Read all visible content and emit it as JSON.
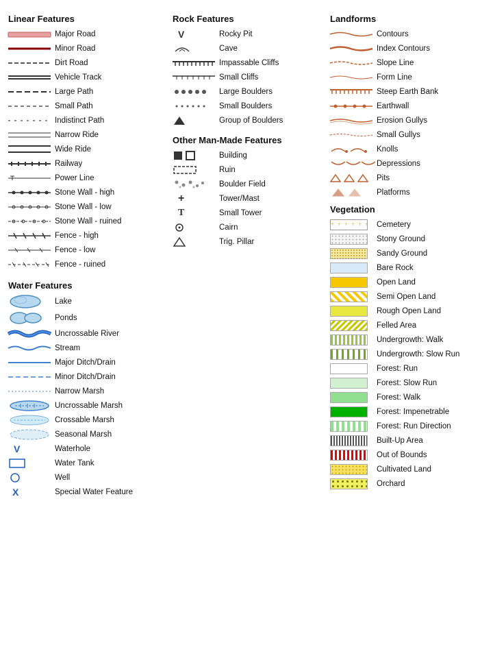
{
  "sections": {
    "linear": {
      "title": "Linear Features",
      "items": [
        {
          "label": "Major Road"
        },
        {
          "label": "Minor Road"
        },
        {
          "label": "Dirt Road"
        },
        {
          "label": "Vehicle Track"
        },
        {
          "label": "Large Path"
        },
        {
          "label": "Small Path"
        },
        {
          "label": "Indistinct Path"
        },
        {
          "label": "Narrow Ride"
        },
        {
          "label": "Wide Ride"
        },
        {
          "label": "Railway"
        },
        {
          "label": "Power Line"
        },
        {
          "label": "Stone Wall - high"
        },
        {
          "label": "Stone Wall - low"
        },
        {
          "label": "Stone Wall - ruined"
        },
        {
          "label": "Fence - high"
        },
        {
          "label": "Fence - low"
        },
        {
          "label": "Fence - ruined"
        }
      ]
    },
    "water": {
      "title": "Water Features",
      "items": [
        {
          "label": "Lake"
        },
        {
          "label": "Ponds"
        },
        {
          "label": "Uncrossable River"
        },
        {
          "label": "Stream"
        },
        {
          "label": "Major Ditch/Drain"
        },
        {
          "label": "Minor Ditch/Drain"
        },
        {
          "label": "Narrow Marsh"
        },
        {
          "label": "Uncrossable Marsh"
        },
        {
          "label": "Crossable Marsh"
        },
        {
          "label": "Seasonal Marsh"
        },
        {
          "label": "Waterhole"
        },
        {
          "label": "Water Tank"
        },
        {
          "label": "Well"
        },
        {
          "label": "Special Water Feature"
        }
      ]
    },
    "rock": {
      "title": "Rock Features",
      "items": [
        {
          "label": "Rocky Pit",
          "symbol": "V"
        },
        {
          "label": "Cave",
          "symbol": "⌒"
        },
        {
          "label": "Impassable Cliffs"
        },
        {
          "label": "Small Cliffs"
        },
        {
          "label": "Large Boulders"
        },
        {
          "label": "Small Boulders"
        },
        {
          "label": "Group of Boulders",
          "symbol": "▲"
        }
      ]
    },
    "manmade": {
      "title": "Other Man-Made Features",
      "items": [
        {
          "label": "Building"
        },
        {
          "label": "Ruin"
        },
        {
          "label": "Boulder Field"
        },
        {
          "label": "Tower/Mast",
          "symbol": "+"
        },
        {
          "label": "Small Tower",
          "symbol": "T"
        },
        {
          "label": "Cairn",
          "symbol": "⊙"
        },
        {
          "label": "Trig. Pillar",
          "symbol": "△"
        }
      ]
    },
    "landforms": {
      "title": "Landforms",
      "items": [
        {
          "label": "Contours"
        },
        {
          "label": "Index Contours"
        },
        {
          "label": "Slope Line"
        },
        {
          "label": "Form Line"
        },
        {
          "label": "Steep Earth Bank"
        },
        {
          "label": "Earthwall"
        },
        {
          "label": "Erosion Gullys"
        },
        {
          "label": "Small Gullys"
        },
        {
          "label": "Knolls"
        },
        {
          "label": "Depressions"
        },
        {
          "label": "Pits"
        },
        {
          "label": "Platforms"
        }
      ]
    },
    "vegetation": {
      "title": "Vegetation",
      "items": [
        {
          "label": "Cemetery",
          "swatch": "cemetery"
        },
        {
          "label": "Stony Ground",
          "swatch": "stony"
        },
        {
          "label": "Sandy Ground",
          "swatch": "sandy"
        },
        {
          "label": "Bare Rock",
          "swatch": "bare-rock"
        },
        {
          "label": "Open Land",
          "swatch": "open-land"
        },
        {
          "label": "Semi Open Land",
          "swatch": "semi-open"
        },
        {
          "label": "Rough Open Land",
          "swatch": "rough-open"
        },
        {
          "label": "Felled Area",
          "swatch": "felled"
        },
        {
          "label": "Undergrowth: Walk",
          "swatch": "under-walk"
        },
        {
          "label": "Undergrowth: Slow Run",
          "swatch": "under-slow"
        },
        {
          "label": "Forest: Run",
          "swatch": "forest-run"
        },
        {
          "label": "Forest: Slow Run",
          "swatch": "forest-slow"
        },
        {
          "label": "Forest: Walk",
          "swatch": "forest-walk"
        },
        {
          "label": "Forest: Impenetrable",
          "swatch": "forest-imp"
        },
        {
          "label": "Forest: Run Direction",
          "swatch": "forest-dir"
        },
        {
          "label": "Built-Up Area",
          "swatch": "built"
        },
        {
          "label": "Out of Bounds",
          "swatch": "oob"
        },
        {
          "label": "Cultivated Land",
          "swatch": "cult"
        },
        {
          "label": "Orchard",
          "swatch": "orchard"
        }
      ]
    }
  }
}
